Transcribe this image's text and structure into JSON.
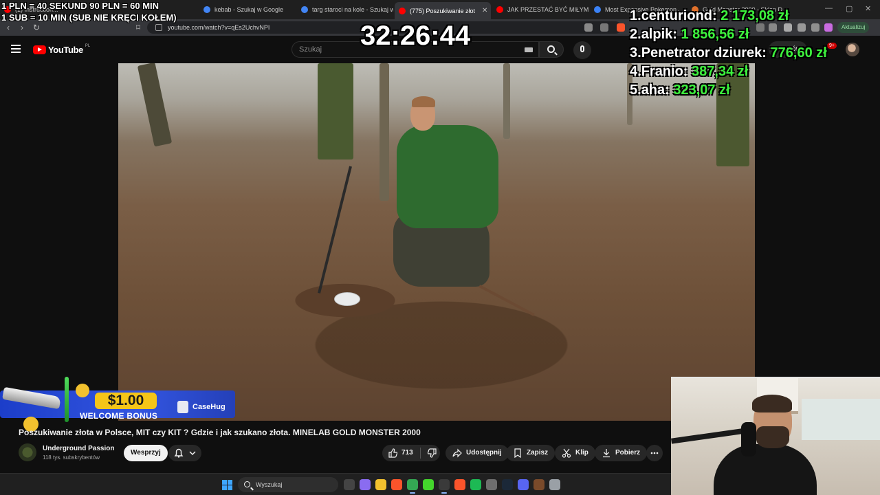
{
  "browser": {
    "tabs": [
      {
        "label": "(1) Instruction...",
        "fav_color": "#ff0000",
        "active": false
      },
      {
        "label": "kebab - Szukaj w Google",
        "fav_color": "#4285f4",
        "active": false
      },
      {
        "label": "targ staroci na kole - Szukaj w",
        "fav_color": "#4285f4",
        "active": false
      },
      {
        "label": "(775) Poszukiwanie złot",
        "fav_color": "#ff0000",
        "active": true
      },
      {
        "label": "JAK PRZESTAĆ BYĆ MIŁYM FAC",
        "fav_color": "#ff0000",
        "active": false
      },
      {
        "label": "Most Expensive Pokemon Jap",
        "fav_color": "#3b82f6",
        "active": false
      },
      {
        "label": "Gold Monster 2000 - Sklep D",
        "fav_color": "#e0702a",
        "active": false
      }
    ],
    "url": "youtube.com/watch?v=qEs2UchvNPI",
    "update_label": "Aktualizuj"
  },
  "youtube": {
    "logo_text": "YouTube",
    "region": "PL",
    "search_placeholder": "Szukaj",
    "create_label": "+ Utwórz",
    "notifications_badge": "9+"
  },
  "overlay": {
    "rules_line1": "1 PLN =  40 SEKUND 90 PLN = 60 MIN",
    "rules_line2": "1 SUB = 10 MIN (SUB NIE KRĘCI KOŁEM)",
    "timer": "32:26:44",
    "donors": [
      {
        "rank": "1.",
        "name": "centuriond:",
        "amount": "2 173,08 zł"
      },
      {
        "rank": "2.",
        "name": "alpik:",
        "amount": "1 856,56 zł"
      },
      {
        "rank": "3.",
        "name": "Penetrator dziurek:",
        "amount": "776,60 zł"
      },
      {
        "rank": "4.",
        "name": "Franio:",
        "amount": "387,34 zł"
      },
      {
        "rank": "5.",
        "name": "aha:",
        "amount": "323,07 zł"
      }
    ]
  },
  "promo": {
    "price": "$1.00",
    "bonus": "WELCOME BONUS",
    "brand": "CaseHug"
  },
  "video": {
    "title": "Poszukiwanie złota w Polsce, MIT czy KIT ? Gdzie i jak szukano złota. MINELAB GOLD MONSTER 2000",
    "channel_name": "Underground Passion",
    "channel_subs": "118 tys. subskrybentów",
    "support_label": "Wesprzyj",
    "likes": "713",
    "share_label": "Udostępnij",
    "save_label": "Zapisz",
    "clip_label": "Klip",
    "download_label": "Pobierz"
  },
  "taskbar": {
    "search_placeholder": "Wyszukaj",
    "apps": [
      {
        "icon": "task-view-icon",
        "color": "#444444"
      },
      {
        "icon": "copilot-icon",
        "color": "#8a6cf0"
      },
      {
        "icon": "file-explorer-icon",
        "color": "#f2c12e"
      },
      {
        "icon": "brave-icon",
        "color": "#fb542b"
      },
      {
        "icon": "chrome-icon",
        "color": "#34a853"
      },
      {
        "icon": "razer-icon",
        "color": "#44d62c"
      },
      {
        "icon": "obs-icon",
        "color": "#3a3a3a"
      },
      {
        "icon": "brave-browser-icon",
        "color": "#fb542b"
      },
      {
        "icon": "spotify-icon",
        "color": "#1db954"
      },
      {
        "icon": "calculator-icon",
        "color": "#6e6e6e"
      },
      {
        "icon": "steam-icon",
        "color": "#1b2838"
      },
      {
        "icon": "discord-icon",
        "color": "#5865f2"
      },
      {
        "icon": "game-icon",
        "color": "#7a4a2a"
      },
      {
        "icon": "settings-icon",
        "color": "#9aa0a6"
      }
    ]
  }
}
